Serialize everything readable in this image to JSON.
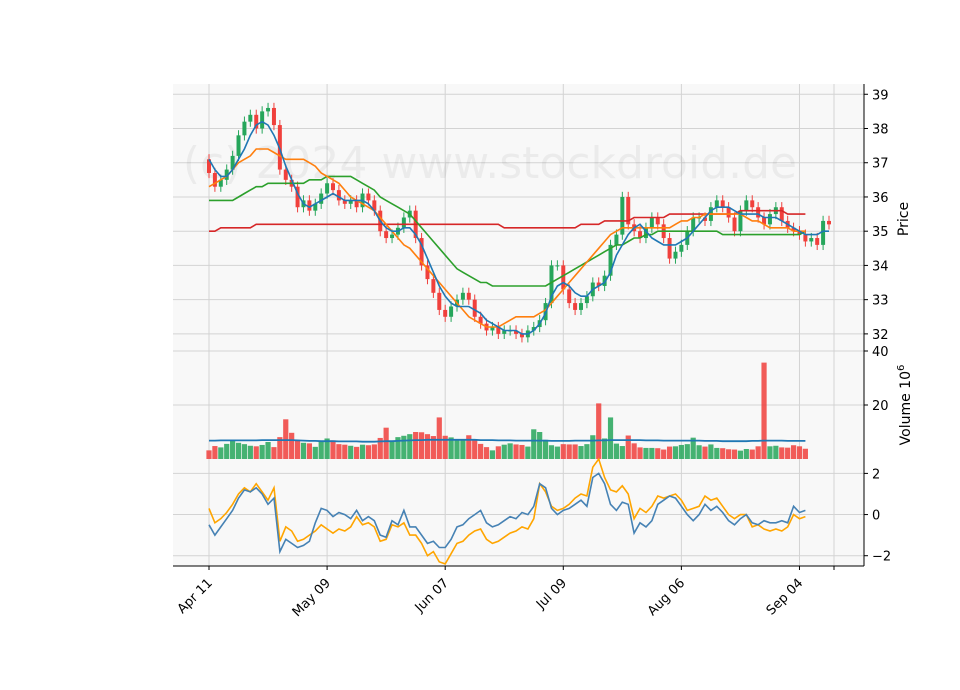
{
  "watermark": "(c) 2024 www.stockdroid.de",
  "colors": {
    "up": "#26a65b",
    "down": "#f0403c",
    "panel_bg": "#f8f8f8",
    "grid": "#d3d3d3",
    "ma_short": "#1f77b4",
    "ma_mid": "#ff7f0e",
    "ma_long": "#2ca02c",
    "ma_longest": "#d62728",
    "osc_a": "#4682b4",
    "osc_b": "#ffa500"
  },
  "chart_data": {
    "type": "candlestick",
    "x_tick_labels": [
      "Apr 11",
      "May 09",
      "Jun 07",
      "Jul 09",
      "Aug 06",
      "Sep 04"
    ],
    "x_tick_index": [
      0,
      20,
      40,
      60,
      80,
      100
    ],
    "price_axis": {
      "label": "Price",
      "ylim": [
        31.5,
        39.3
      ],
      "ticks": [
        32,
        33,
        34,
        35,
        36,
        37,
        38,
        39
      ]
    },
    "volume_axis": {
      "label": "Volume  10",
      "label_sup": "6",
      "ylim": [
        0,
        40
      ],
      "ticks": [
        20,
        40
      ]
    },
    "osc_axis": {
      "ylim": [
        -2.5,
        2.7
      ],
      "ticks": [
        -2,
        0,
        2
      ],
      "tick_labels": [
        "−2",
        "0",
        "2"
      ]
    },
    "close": [
      36.7,
      36.3,
      36.5,
      36.8,
      37.2,
      37.8,
      38.2,
      38.4,
      38.0,
      38.5,
      38.6,
      38.1,
      36.8,
      36.5,
      36.3,
      35.7,
      35.9,
      35.6,
      35.8,
      36.1,
      36.4,
      36.2,
      35.9,
      35.8,
      35.9,
      35.7,
      36.1,
      35.9,
      35.6,
      35.0,
      34.8,
      34.9,
      35.1,
      35.4,
      35.6,
      34.8,
      34.0,
      33.6,
      33.2,
      32.7,
      32.5,
      32.8,
      33.0,
      33.2,
      33.0,
      32.5,
      32.3,
      32.1,
      32.2,
      32.0,
      32.1,
      32.1,
      32.0,
      31.9,
      32.1,
      32.2,
      32.4,
      32.9,
      34.0,
      34.0,
      33.3,
      32.9,
      32.7,
      32.9,
      33.1,
      33.5,
      33.4,
      33.7,
      34.6,
      34.9,
      36.0,
      35.2,
      35.0,
      34.8,
      35.1,
      35.4,
      35.2,
      34.8,
      34.2,
      34.4,
      34.6,
      35.0,
      35.4,
      35.4,
      35.3,
      35.7,
      35.9,
      35.7,
      35.4,
      35.0,
      35.6,
      35.9,
      35.7,
      35.4,
      35.2,
      35.5,
      35.7,
      35.3,
      35.1,
      35.0,
      34.9,
      34.7,
      34.8,
      34.6,
      35.3,
      35.2
    ],
    "volume": [
      3.2,
      4.8,
      4.3,
      5.6,
      7.1,
      6.0,
      5.5,
      4.9,
      4.7,
      5.2,
      6.3,
      4.4,
      8.1,
      14.7,
      9.7,
      7.0,
      6.0,
      5.8,
      4.5,
      6.8,
      7.6,
      6.9,
      5.5,
      5.3,
      4.9,
      4.5,
      5.3,
      5.1,
      5.4,
      7.8,
      11.6,
      6.8,
      8.1,
      8.6,
      9.2,
      10.0,
      9.9,
      9.2,
      8.5,
      15.4,
      8.6,
      8.0,
      6.9,
      7.4,
      8.8,
      6.9,
      5.6,
      4.4,
      3.2,
      4.7,
      5.3,
      5.8,
      5.4,
      5.2,
      4.6,
      11.0,
      10.0,
      7.1,
      5.1,
      4.6,
      5.5,
      5.4,
      5.4,
      4.8,
      5.5,
      8.8,
      20.6,
      7.6,
      15.4,
      5.7,
      4.8,
      8.7,
      5.8,
      4.3,
      4.1,
      4.1,
      4.0,
      3.5,
      4.6,
      4.7,
      5.2,
      5.5,
      7.9,
      5.1,
      4.6,
      5.4,
      4.1,
      4.0,
      3.6,
      3.5,
      3.1,
      3.7,
      3.5,
      4.7,
      35.7,
      4.7,
      4.9,
      4.3,
      4.2,
      5.1,
      4.7,
      3.8
    ],
    "volume_ma": [
      6.8,
      6.8,
      6.9,
      6.9,
      6.9,
      6.9,
      6.9,
      6.9,
      6.9,
      7.0,
      7.0,
      7.0,
      7.0,
      7.0,
      7.0,
      6.9,
      6.8,
      6.7,
      6.7,
      6.6,
      6.6,
      6.6,
      6.5,
      6.5,
      6.5,
      6.5,
      6.4,
      6.4,
      6.4,
      6.5,
      6.6,
      6.6,
      6.7,
      6.8,
      6.9,
      7.0,
      7.0,
      7.1,
      7.1,
      7.1,
      7.1,
      7.1,
      7.1,
      7.1,
      7.1,
      7.1,
      7.0,
      7.0,
      7.0,
      6.9,
      6.9,
      6.9,
      6.8,
      6.8,
      6.8,
      6.8,
      6.8,
      6.8,
      6.7,
      6.7,
      6.7,
      6.7,
      6.8,
      6.8,
      6.8,
      6.8,
      6.9,
      6.9,
      7.0,
      7.0,
      7.0,
      7.0,
      7.0,
      7.0,
      6.9,
      6.9,
      6.9,
      6.8,
      6.8,
      6.8,
      6.8,
      6.8,
      6.8,
      6.8,
      6.7,
      6.7,
      6.7,
      6.6,
      6.6,
      6.6,
      6.6,
      6.6,
      6.7,
      6.7,
      6.8,
      6.8,
      6.8,
      6.8,
      6.7,
      6.7,
      6.7,
      6.7
    ],
    "osc_a": [
      -0.5,
      -1.0,
      -0.6,
      -0.2,
      0.2,
      0.8,
      1.2,
      1.1,
      1.3,
      1.0,
      0.5,
      0.8,
      -1.8,
      -1.2,
      -1.4,
      -1.6,
      -1.5,
      -1.3,
      -0.4,
      0.3,
      0.2,
      -0.1,
      0.1,
      0.0,
      -0.2,
      0.2,
      -0.3,
      -0.1,
      -0.3,
      -1.0,
      -1.1,
      -0.3,
      -0.5,
      0.2,
      -0.6,
      -0.6,
      -1.0,
      -1.4,
      -1.3,
      -1.6,
      -1.6,
      -1.2,
      -0.6,
      -0.5,
      -0.2,
      0.0,
      0.2,
      -0.4,
      -0.6,
      -0.5,
      -0.3,
      -0.1,
      -0.2,
      0.1,
      0.0,
      0.4,
      1.5,
      1.3,
      0.3,
      0.0,
      0.2,
      0.3,
      0.5,
      0.7,
      0.4,
      1.8,
      2.0,
      1.5,
      0.5,
      0.2,
      0.6,
      0.5,
      -0.9,
      -0.4,
      -0.6,
      -0.3,
      0.5,
      0.7,
      0.9,
      0.8,
      0.4,
      0.0,
      -0.3,
      0.0,
      0.5,
      0.2,
      0.4,
      0.1,
      -0.3,
      -0.5,
      -0.2,
      0.0,
      -0.4,
      -0.5,
      -0.3,
      -0.4,
      -0.4,
      -0.3,
      -0.4,
      0.4,
      0.1,
      0.2
    ],
    "osc_b": [
      0.3,
      -0.4,
      -0.2,
      0.1,
      0.5,
      1.0,
      1.3,
      1.1,
      1.5,
      1.1,
      0.7,
      1.3,
      -1.3,
      -0.6,
      -0.8,
      -1.3,
      -1.2,
      -1.0,
      -0.8,
      -0.5,
      -0.7,
      -0.9,
      -0.7,
      -0.8,
      -0.6,
      -0.1,
      -0.5,
      -0.4,
      -0.6,
      -1.3,
      -1.2,
      -0.5,
      -0.6,
      -0.4,
      -1.0,
      -1.0,
      -1.4,
      -2.0,
      -1.8,
      -2.3,
      -2.4,
      -1.9,
      -1.4,
      -1.3,
      -1.0,
      -0.8,
      -0.7,
      -1.2,
      -1.4,
      -1.3,
      -1.1,
      -0.9,
      -0.8,
      -0.6,
      -0.7,
      -0.2,
      1.5,
      1.1,
      0.4,
      0.2,
      0.3,
      0.5,
      0.8,
      1.0,
      0.9,
      2.3,
      2.7,
      1.8,
      1.2,
      1.1,
      1.4,
      1.0,
      -0.2,
      0.3,
      0.1,
      0.4,
      0.9,
      0.8,
      0.9,
      1.0,
      0.7,
      0.2,
      0.3,
      0.4,
      0.9,
      0.7,
      0.8,
      0.4,
      0.0,
      -0.2,
      0.0,
      0.0,
      -0.6,
      -0.5,
      -0.7,
      -0.8,
      -0.7,
      -0.8,
      -0.6,
      0.0,
      -0.2,
      -0.1
    ],
    "ma_short": [
      37.1,
      36.8,
      36.6,
      36.6,
      36.8,
      37.1,
      37.4,
      37.8,
      38.1,
      38.2,
      38.1,
      37.8,
      37.4,
      36.9,
      36.5,
      36.1,
      35.8,
      35.7,
      35.8,
      35.9,
      36.0,
      36.1,
      36.0,
      35.9,
      35.9,
      35.9,
      35.9,
      35.8,
      35.6,
      35.3,
      35.1,
      35.0,
      35.0,
      35.1,
      35.1,
      34.9,
      34.6,
      34.2,
      33.8,
      33.4,
      33.1,
      32.9,
      32.8,
      32.8,
      32.8,
      32.7,
      32.6,
      32.4,
      32.3,
      32.2,
      32.1,
      32.1,
      32.1,
      32.0,
      32.0,
      32.1,
      32.3,
      32.6,
      33.1,
      33.4,
      33.5,
      33.4,
      33.2,
      33.1,
      33.1,
      33.3,
      33.4,
      33.5,
      33.8,
      34.3,
      34.6,
      34.9,
      35.1,
      35.2,
      35.0,
      34.8,
      34.7,
      34.6,
      34.6,
      34.6,
      34.7,
      34.8,
      35.0,
      35.2,
      35.4,
      35.6,
      35.7,
      35.7,
      35.7,
      35.6,
      35.5,
      35.5,
      35.5,
      35.5,
      35.4,
      35.4,
      35.4,
      35.3,
      35.2,
      35.1,
      35.0,
      34.9,
      34.9,
      34.9,
      35.0,
      35.0
    ],
    "ma_mid": [
      36.3,
      36.4,
      36.5,
      36.6,
      36.8,
      37.0,
      37.1,
      37.2,
      37.4,
      37.4,
      37.4,
      37.3,
      37.2,
      37.1,
      37.1,
      37.1,
      37.1,
      37.0,
      36.9,
      36.7,
      36.6,
      36.5,
      36.4,
      36.2,
      36.0,
      35.9,
      35.8,
      35.7,
      35.6,
      35.4,
      35.2,
      35.0,
      34.8,
      34.6,
      34.5,
      34.3,
      34.1,
      33.9,
      33.7,
      33.5,
      33.3,
      33.1,
      32.9,
      32.7,
      32.5,
      32.4,
      32.3,
      32.2,
      32.2,
      32.2,
      32.3,
      32.4,
      32.5,
      32.5,
      32.5,
      32.5,
      32.6,
      32.7,
      32.9,
      33.1,
      33.3,
      33.5,
      33.7,
      33.9,
      34.1,
      34.3,
      34.5,
      34.7,
      34.9,
      35.0,
      35.1,
      35.1,
      35.1,
      35.1,
      35.1,
      35.1,
      35.1,
      35.1,
      35.1,
      35.2,
      35.3,
      35.3,
      35.4,
      35.4,
      35.5,
      35.5,
      35.5,
      35.5,
      35.5,
      35.5,
      35.5,
      35.4,
      35.3,
      35.3,
      35.2,
      35.1,
      35.1,
      35.1,
      35.1,
      35.0,
      35.0,
      35.0
    ],
    "ma_long": [
      35.9,
      35.9,
      35.9,
      35.9,
      35.9,
      36.0,
      36.1,
      36.2,
      36.3,
      36.3,
      36.4,
      36.4,
      36.4,
      36.4,
      36.4,
      36.4,
      36.4,
      36.5,
      36.5,
      36.5,
      36.6,
      36.6,
      36.6,
      36.6,
      36.6,
      36.5,
      36.4,
      36.3,
      36.2,
      36.0,
      35.9,
      35.8,
      35.7,
      35.6,
      35.5,
      35.3,
      35.1,
      34.9,
      34.7,
      34.5,
      34.3,
      34.1,
      33.9,
      33.8,
      33.7,
      33.6,
      33.5,
      33.5,
      33.4,
      33.4,
      33.4,
      33.4,
      33.4,
      33.4,
      33.4,
      33.4,
      33.4,
      33.4,
      33.5,
      33.6,
      33.7,
      33.8,
      33.9,
      34.0,
      34.1,
      34.2,
      34.3,
      34.4,
      34.5,
      34.6,
      34.6,
      34.7,
      34.8,
      34.8,
      34.9,
      34.9,
      35.0,
      35.0,
      35.0,
      35.0,
      35.0,
      35.0,
      35.0,
      35.0,
      35.0,
      35.0,
      35.0,
      34.9,
      34.9,
      34.9,
      34.9,
      34.9,
      34.9,
      34.9,
      34.9,
      34.9,
      34.9,
      34.9,
      34.9,
      34.9,
      34.9,
      35.0
    ],
    "ma_longest": [
      35.0,
      35.0,
      35.1,
      35.1,
      35.1,
      35.1,
      35.1,
      35.1,
      35.2,
      35.2,
      35.2,
      35.2,
      35.2,
      35.2,
      35.2,
      35.2,
      35.2,
      35.2,
      35.2,
      35.2,
      35.2,
      35.2,
      35.2,
      35.2,
      35.2,
      35.2,
      35.2,
      35.2,
      35.2,
      35.2,
      35.2,
      35.2,
      35.2,
      35.2,
      35.2,
      35.2,
      35.2,
      35.2,
      35.2,
      35.2,
      35.2,
      35.2,
      35.2,
      35.2,
      35.2,
      35.2,
      35.2,
      35.2,
      35.2,
      35.2,
      35.1,
      35.1,
      35.1,
      35.1,
      35.1,
      35.1,
      35.1,
      35.1,
      35.1,
      35.1,
      35.1,
      35.1,
      35.1,
      35.2,
      35.2,
      35.2,
      35.2,
      35.3,
      35.3,
      35.3,
      35.3,
      35.3,
      35.4,
      35.4,
      35.4,
      35.4,
      35.4,
      35.4,
      35.5,
      35.5,
      35.5,
      35.5,
      35.5,
      35.5,
      35.5,
      35.5,
      35.5,
      35.5,
      35.5,
      35.5,
      35.6,
      35.6,
      35.6,
      35.6,
      35.6,
      35.6,
      35.6,
      35.6,
      35.5,
      35.5,
      35.5,
      35.5
    ]
  }
}
